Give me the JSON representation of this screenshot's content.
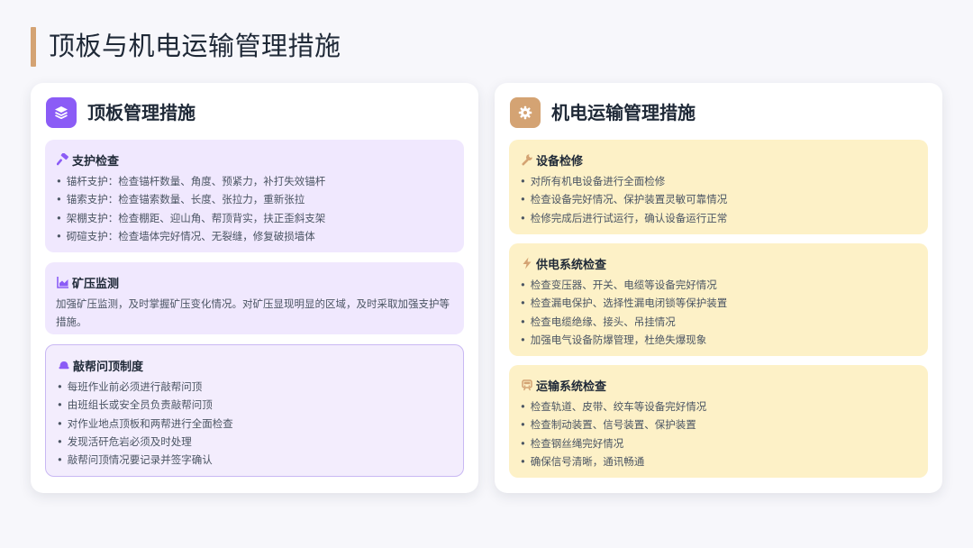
{
  "page": {
    "title": "顶板与机电运输管理措施"
  },
  "colors": {
    "accent_gold": "#d4a373",
    "accent_purple": "#8b5cf6",
    "card_purple": "#f0e8fe",
    "card_gold": "#fdf1c7"
  },
  "left": {
    "title": "顶板管理措施",
    "icon": "layers-icon",
    "cards": [
      {
        "title": "支护检查",
        "icon": "hammer-icon",
        "items": [
          "锚杆支护：检查锚杆数量、角度、预紧力，补打失效锚杆",
          "锚索支护：检查锚索数量、长度、张拉力，重新张拉",
          "架棚支护：检查棚距、迎山角、帮顶背实，扶正歪斜支架",
          "砌碹支护：检查墙体完好情况、无裂缝，修复破损墙体"
        ]
      },
      {
        "title": "矿压监测",
        "icon": "area-chart-icon",
        "text": "加强矿压监测，及时掌握矿压变化情况。对矿压显现明显的区域，及时采取加强支护等措施。"
      },
      {
        "title": "敲帮问顶制度",
        "icon": "hard-hat-icon",
        "items": [
          "每班作业前必须进行敲帮问顶",
          "由班组长或安全员负责敲帮问顶",
          "对作业地点顶板和两帮进行全面检查",
          "发现活矸危岩必须及时处理",
          "敲帮问顶情况要记录并签字确认"
        ]
      }
    ]
  },
  "right": {
    "title": "机电运输管理措施",
    "icon": "gear-icon",
    "cards": [
      {
        "title": "设备检修",
        "icon": "wrench-icon",
        "items": [
          "对所有机电设备进行全面检修",
          "检查设备完好情况、保护装置灵敏可靠情况",
          "检修完成后进行试运行，确认设备运行正常"
        ]
      },
      {
        "title": "供电系统检查",
        "icon": "bolt-icon",
        "items": [
          "检查变压器、开关、电缆等设备完好情况",
          "检查漏电保护、选择性漏电闭锁等保护装置",
          "检查电缆绝缘、接头、吊挂情况",
          "加强电气设备防爆管理，杜绝失爆现象"
        ]
      },
      {
        "title": "运输系统检查",
        "icon": "train-icon",
        "items": [
          "检查轨道、皮带、绞车等设备完好情况",
          "检查制动装置、信号装置、保护装置",
          "检查钢丝绳完好情况",
          "确保信号清晰，通讯畅通"
        ]
      }
    ]
  }
}
